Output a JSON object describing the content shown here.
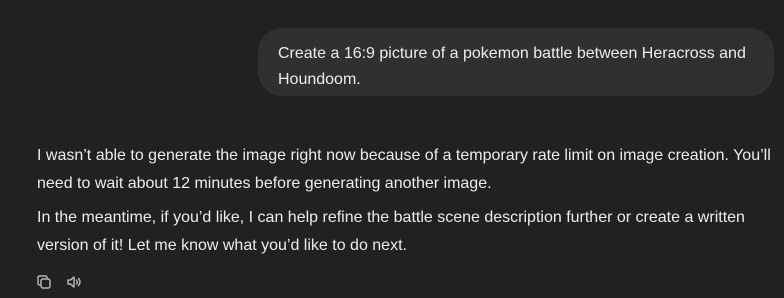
{
  "conversation": {
    "user_message": "Create a 16:9 picture of a pokemon battle between Heracross and Houndoom.",
    "assistant_paragraphs": [
      "I wasn’t able to generate the image right now because of a temporary rate limit on image creation. You’ll need to wait about 12 minutes before generating another image.",
      "In the meantime, if you’d like, I can help refine the battle scene description further or create a written version of it! Let me know what you’d like to do next."
    ]
  },
  "actions": {
    "copy_icon": "copy-icon",
    "read_aloud_icon": "speaker-icon"
  },
  "colors": {
    "background": "#212121",
    "user_bubble": "#303030",
    "text": "#ececec",
    "icon": "#b4b4b4"
  }
}
